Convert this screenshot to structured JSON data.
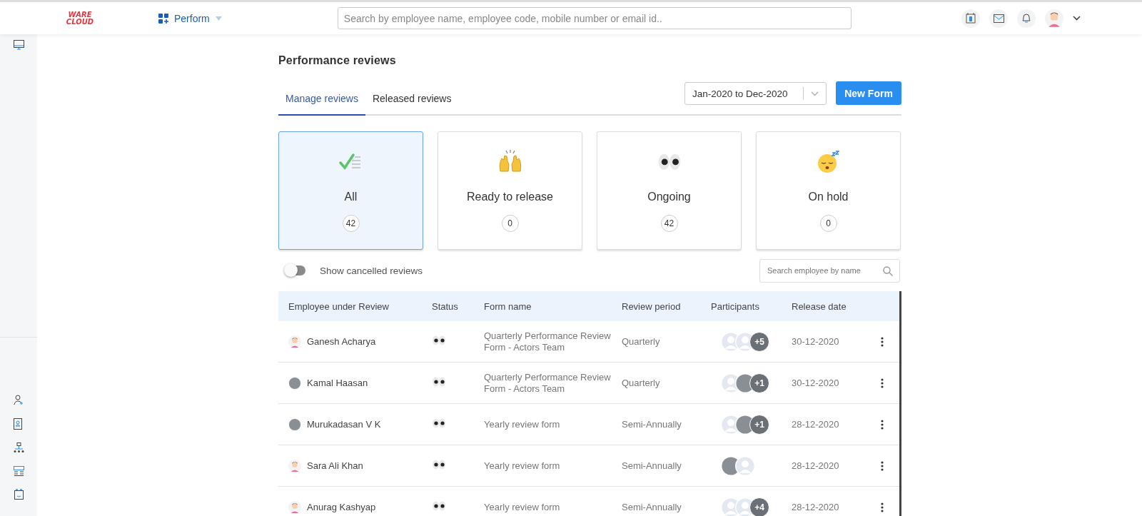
{
  "header": {
    "logo": "WARE CLOUD",
    "module": "Perform",
    "search_placeholder": "Search by employee name, employee code, mobile number or email id.."
  },
  "page_title": "Performance reviews",
  "tabs": [
    {
      "label": "Manage reviews",
      "selected": true
    },
    {
      "label": "Released reviews",
      "selected": false
    }
  ],
  "period_select": {
    "value": "Jan-2020 to Dec-2020"
  },
  "new_button": "New Form",
  "summary_cards": [
    {
      "kind": "all",
      "label": "All",
      "count": "42",
      "selected": true
    },
    {
      "kind": "ready",
      "label": "Ready to release",
      "count": "0",
      "selected": false
    },
    {
      "kind": "ongoing",
      "label": "Ongoing",
      "count": "42",
      "selected": false
    },
    {
      "kind": "hold",
      "label": "On hold",
      "count": "0",
      "selected": false
    }
  ],
  "cancelled_toggle": {
    "label": "Show cancelled reviews",
    "on": false
  },
  "employee_search": {
    "placeholder": "Search employee by name"
  },
  "table": {
    "columns": [
      "Employee under Review",
      "Status",
      "Form name",
      "Review period",
      "Participants",
      "Release date"
    ],
    "rows": [
      {
        "employee": "Ganesh Acharya",
        "avatar": {
          "kind": "cartoon"
        },
        "status": {
          "kind": "ongoing"
        },
        "form_name": "Quarterly Performance Review Form - Actors Team",
        "review_period": "Quarterly",
        "participants": [
          {
            "kind": "placeholder"
          },
          {
            "kind": "placeholder"
          }
        ],
        "extra": "+5",
        "release_date": "30-12-2020"
      },
      {
        "employee": "Kamal Haasan",
        "avatar": {
          "kind": "photo"
        },
        "status": {
          "kind": "ongoing"
        },
        "form_name": "Quarterly Performance Review Form - Actors Team",
        "review_period": "Quarterly",
        "participants": [
          {
            "kind": "placeholder"
          },
          {
            "kind": "photo"
          }
        ],
        "extra": "+1",
        "release_date": "30-12-2020"
      },
      {
        "employee": "Murukadasan V K",
        "avatar": {
          "kind": "photo"
        },
        "status": {
          "kind": "ongoing"
        },
        "form_name": "Yearly review form",
        "review_period": "Semi-Annually",
        "participants": [
          {
            "kind": "placeholder"
          },
          {
            "kind": "photo"
          }
        ],
        "extra": "+1",
        "release_date": "28-12-2020"
      },
      {
        "employee": "Sara Ali Khan",
        "avatar": {
          "kind": "cartoon"
        },
        "status": {
          "kind": "ongoing"
        },
        "form_name": "Yearly review form",
        "review_period": "Semi-Annually",
        "participants": [
          {
            "kind": "photo"
          },
          {
            "kind": "placeholder"
          }
        ],
        "release_date": "28-12-2020"
      },
      {
        "employee": "Anurag Kashyap",
        "avatar": {
          "kind": "cartoon"
        },
        "status": {
          "kind": "ongoing"
        },
        "form_name": "Yearly review form",
        "review_period": "Semi-Annually",
        "participants": [
          {
            "kind": "placeholder"
          },
          {
            "kind": "placeholder"
          }
        ],
        "extra": "+4",
        "release_date": "28-12-2020"
      }
    ]
  }
}
